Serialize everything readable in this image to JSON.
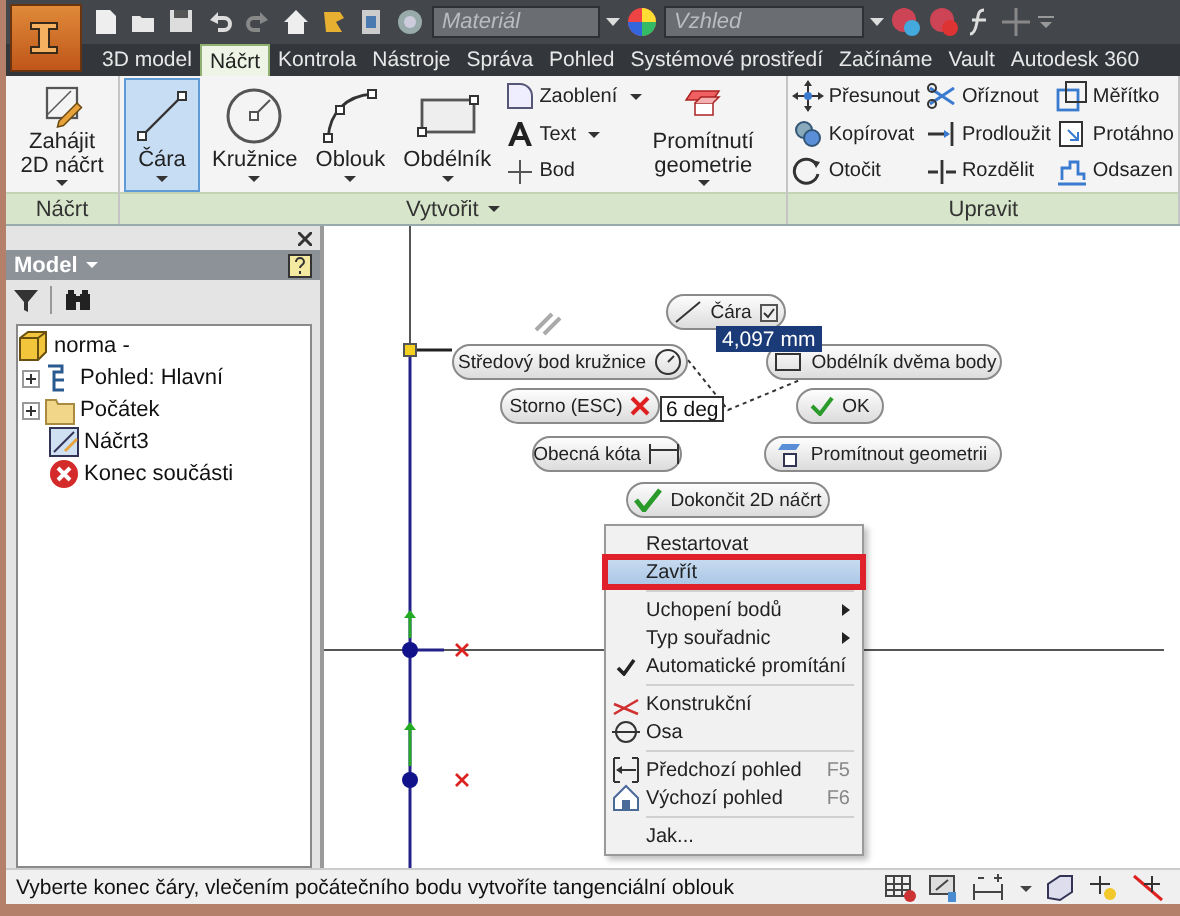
{
  "quick_access": {
    "material": "Materiál",
    "appearance": "Vzhled"
  },
  "tabs": [
    {
      "label": "3D model",
      "selected": false
    },
    {
      "label": "Náčrt",
      "selected": true
    },
    {
      "label": "Kontrola",
      "selected": false
    },
    {
      "label": "Nástroje",
      "selected": false
    },
    {
      "label": "Správa",
      "selected": false
    },
    {
      "label": "Pohled",
      "selected": false
    },
    {
      "label": "Systémové prostředí",
      "selected": false
    },
    {
      "label": "Začínáme",
      "selected": false
    },
    {
      "label": "Vault",
      "selected": false
    },
    {
      "label": "Autodesk 360",
      "selected": false
    }
  ],
  "ribbon": [
    {
      "title": "Náčrt",
      "dropdown": false,
      "tools": [
        {
          "kind": "large",
          "label": "Zahájit 2D náčrt",
          "selected": false,
          "dropdown": true
        }
      ]
    },
    {
      "title": "Vytvořit",
      "dropdown": true,
      "tools": [
        {
          "kind": "large",
          "label": "Čára",
          "selected": true,
          "dropdown": true
        },
        {
          "kind": "large",
          "label": "Kružnice",
          "selected": false,
          "dropdown": true
        },
        {
          "kind": "large",
          "label": "Oblouk",
          "selected": false,
          "dropdown": true
        },
        {
          "kind": "large",
          "label": "Obdélník",
          "selected": false,
          "dropdown": true
        },
        {
          "kind": "stack",
          "items": [
            {
              "label": "Zaoblení",
              "dropdown": true
            },
            {
              "label": "Text",
              "dropdown": true
            },
            {
              "label": "Bod",
              "dropdown": false
            }
          ]
        },
        {
          "kind": "large",
          "label": "Promítnutí geometrie",
          "selected": false,
          "dropdown": true
        }
      ]
    },
    {
      "title": "Upravit",
      "dropdown": false,
      "tools": [
        {
          "kind": "stack",
          "items": [
            {
              "label": "Přesunout",
              "dropdown": false
            },
            {
              "label": "Kopírovat",
              "dropdown": false
            },
            {
              "label": "Otočit",
              "dropdown": false
            }
          ]
        },
        {
          "kind": "stack",
          "items": [
            {
              "label": "Oříznout",
              "dropdown": false
            },
            {
              "label": "Prodloužit",
              "dropdown": false
            },
            {
              "label": "Rozdělit",
              "dropdown": false
            }
          ]
        },
        {
          "kind": "stack",
          "items": [
            {
              "label": "Měřítko",
              "dropdown": false
            },
            {
              "label": "Protáhno",
              "dropdown": false
            },
            {
              "label": "Odsazen",
              "dropdown": false
            }
          ]
        }
      ]
    }
  ],
  "browser": {
    "title": "Model",
    "tree": [
      {
        "label": "norma -",
        "children": [
          {
            "label": "Pohled: Hlavní",
            "expanded": false
          },
          {
            "label": "Počátek",
            "expanded": false
          },
          {
            "label": "Náčrt3"
          },
          {
            "label": "Konec součásti"
          }
        ]
      }
    ]
  },
  "sketch_inputs": [
    {
      "value": "4,097 mm",
      "selected": true
    },
    {
      "value": "6 deg",
      "selected": false
    }
  ],
  "marking_menu": [
    {
      "label": "Čára"
    },
    {
      "label": "Středový bod kružnice"
    },
    {
      "label": "Obdélník dvěma body"
    },
    {
      "label": "Storno (ESC)"
    },
    {
      "label": "OK"
    },
    {
      "label": "Obecná kóta"
    },
    {
      "label": "Promítnout geometrii"
    },
    {
      "label": "Dokončit 2D náčrt"
    }
  ],
  "context_menu": {
    "groups": [
      [
        {
          "label": "Restartovat",
          "selected": false
        },
        {
          "label": "Zavřít",
          "selected": true
        }
      ],
      [
        {
          "label": "Uchopení bodů",
          "selected": false,
          "submenu": true
        },
        {
          "label": "Typ souřadnic",
          "selected": false,
          "submenu": true
        },
        {
          "label": "Automatické promítání",
          "selected": false,
          "checked": true
        }
      ],
      [
        {
          "label": "Konstrukční",
          "selected": false
        },
        {
          "label": "Osa",
          "selected": false
        }
      ],
      [
        {
          "label": "Předchozí pohled",
          "selected": false,
          "shortcut": "F5"
        },
        {
          "label": "Výchozí pohled",
          "selected": false,
          "shortcut": "F6"
        }
      ],
      [
        {
          "label": "Jak...",
          "selected": false
        }
      ]
    ]
  },
  "status_bar": {
    "message": "Vyberte konec čáry, vlečením počátečního bodu vytvoříte tangenciální oblouk"
  }
}
